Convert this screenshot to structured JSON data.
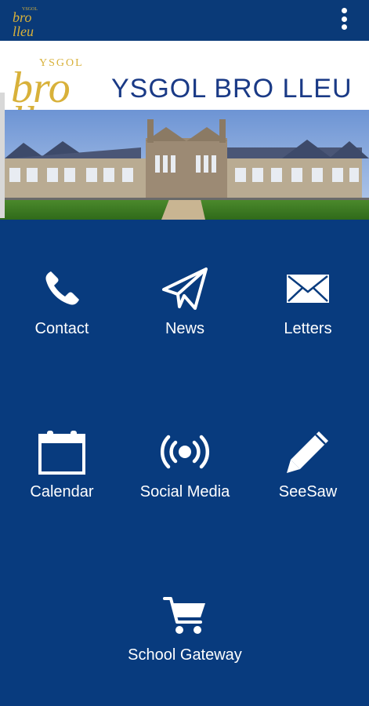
{
  "app": {
    "name": "YSGOL BRO LLEU",
    "logo_text_top": "YSGOL",
    "logo_text_main": "bro",
    "logo_text_bottom": "lleu"
  },
  "colors": {
    "background": "#083b7e",
    "appbar": "#0a3a78",
    "logo_gold": "#d8b13a",
    "title_blue": "#1a3a86"
  },
  "menu": {
    "icon": "more-vert-icon"
  },
  "tiles": [
    {
      "label": "Contact",
      "icon": "phone-icon"
    },
    {
      "label": "News",
      "icon": "paper-plane-icon"
    },
    {
      "label": "Letters",
      "icon": "envelope-icon"
    },
    {
      "label": "Calendar",
      "icon": "calendar-icon"
    },
    {
      "label": "Social Media",
      "icon": "broadcast-icon"
    },
    {
      "label": "SeeSaw",
      "icon": "pencil-icon"
    },
    {
      "label": "School Gateway",
      "icon": "cart-icon"
    }
  ]
}
